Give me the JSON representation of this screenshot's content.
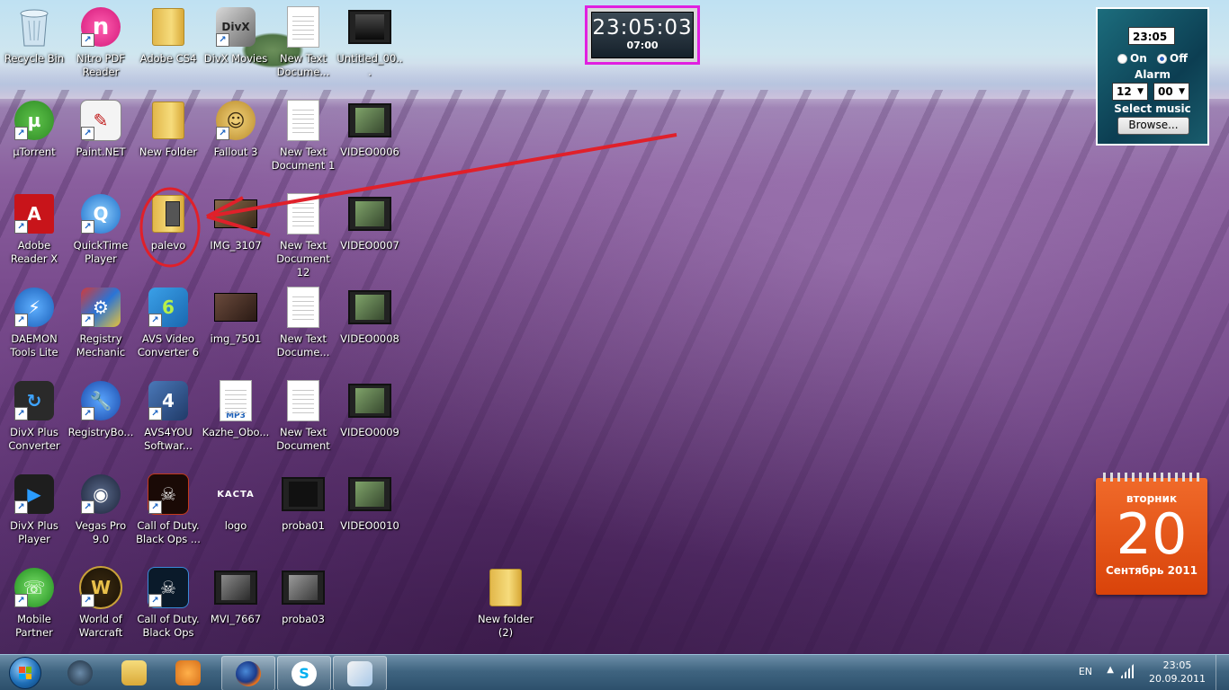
{
  "desktop_icons": [
    {
      "label": "Recycle Bin",
      "icon": "recycle-bin-icon"
    },
    {
      "label": "Nitro PDF Reader",
      "icon": "nitro-pdf-icon"
    },
    {
      "label": "Adobe CS4",
      "icon": "folder-icon"
    },
    {
      "label": "DivX Movies",
      "icon": "divx-movies-icon"
    },
    {
      "label": "New Text Docume...",
      "icon": "text-document-icon"
    },
    {
      "label": "Untitled_00...",
      "icon": "video-file-icon"
    },
    {
      "label": "µTorrent",
      "icon": "utorrent-icon"
    },
    {
      "label": "Paint.NET",
      "icon": "paint-net-icon"
    },
    {
      "label": "New Folder",
      "icon": "folder-icon"
    },
    {
      "label": "Fallout 3",
      "icon": "fallout-icon"
    },
    {
      "label": "New Text Document 1",
      "icon": "text-document-icon"
    },
    {
      "label": "VIDEO0006",
      "icon": "video-file-icon"
    },
    {
      "label": "Adobe Reader X",
      "icon": "adobe-reader-icon"
    },
    {
      "label": "QuickTime Player",
      "icon": "quicktime-icon"
    },
    {
      "label": "palevo",
      "icon": "folder-icon"
    },
    {
      "label": "IMG_3107",
      "icon": "image-file-icon"
    },
    {
      "label": "New Text Document 12",
      "icon": "text-document-icon"
    },
    {
      "label": "VIDEO0007",
      "icon": "video-file-icon"
    },
    {
      "label": "DAEMON Tools Lite",
      "icon": "daemon-tools-icon"
    },
    {
      "label": "Registry Mechanic",
      "icon": "registry-mechanic-icon"
    },
    {
      "label": "AVS Video Converter 6",
      "icon": "avs-converter-icon"
    },
    {
      "label": "img_7501",
      "icon": "image-file-icon"
    },
    {
      "label": "New Text Docume...",
      "icon": "text-document-icon"
    },
    {
      "label": "VIDEO0008",
      "icon": "video-file-icon"
    },
    {
      "label": "DivX Plus Converter",
      "icon": "divx-converter-icon"
    },
    {
      "label": "RegistryBo...",
      "icon": "registry-booster-icon"
    },
    {
      "label": "AVS4YOU Softwar...",
      "icon": "avs4you-icon"
    },
    {
      "label": "Kazhe_Obo...",
      "icon": "mp3-file-icon"
    },
    {
      "label": "New Text Document",
      "icon": "text-document-icon"
    },
    {
      "label": "VIDEO0009",
      "icon": "video-file-icon"
    },
    {
      "label": "DivX Plus Player",
      "icon": "divx-player-icon"
    },
    {
      "label": "Vegas Pro 9.0",
      "icon": "vegas-pro-icon"
    },
    {
      "label": "Call of Duty. Black Ops ...",
      "icon": "black-ops-icon"
    },
    {
      "label": "logo",
      "icon": "image-file-icon"
    },
    {
      "label": "proba01",
      "icon": "video-file-icon"
    },
    {
      "label": "VIDEO0010",
      "icon": "video-file-icon"
    },
    {
      "label": "Mobile Partner",
      "icon": "mobile-partner-icon"
    },
    {
      "label": "World of Warcraft",
      "icon": "warcraft-icon"
    },
    {
      "label": "Call of Duty. Black Ops",
      "icon": "black-ops-icon"
    },
    {
      "label": "MVI_7667",
      "icon": "video-file-icon"
    },
    {
      "label": "proba03",
      "icon": "video-file-icon"
    },
    {
      "label": "New folder (2)",
      "icon": "folder-icon"
    }
  ],
  "clock_gadget": {
    "time": "23:05:03",
    "alarm": "07:00"
  },
  "alarm_gadget": {
    "time": "23:05",
    "on_label": "On",
    "off_label": "Off",
    "selected": "Off",
    "alarm_label": "Alarm",
    "hour": "12",
    "minute": "00",
    "music_label": "Select music",
    "browse_label": "Browse..."
  },
  "calendar_gadget": {
    "weekday": "вторник",
    "day": "20",
    "month_year": "Сентябрь 2011"
  },
  "taskbar": {
    "pinned": [
      "media-center-icon",
      "explorer-icon",
      "media-player-icon",
      "firefox-icon",
      "skype-icon",
      "paint-icon"
    ],
    "tray": {
      "language": "EN",
      "time": "23:05",
      "date": "20.09.2011"
    }
  },
  "colors": {
    "annotation": "#e0202a",
    "clock_highlight": "#e020e0",
    "calendar": "#e8531a"
  }
}
